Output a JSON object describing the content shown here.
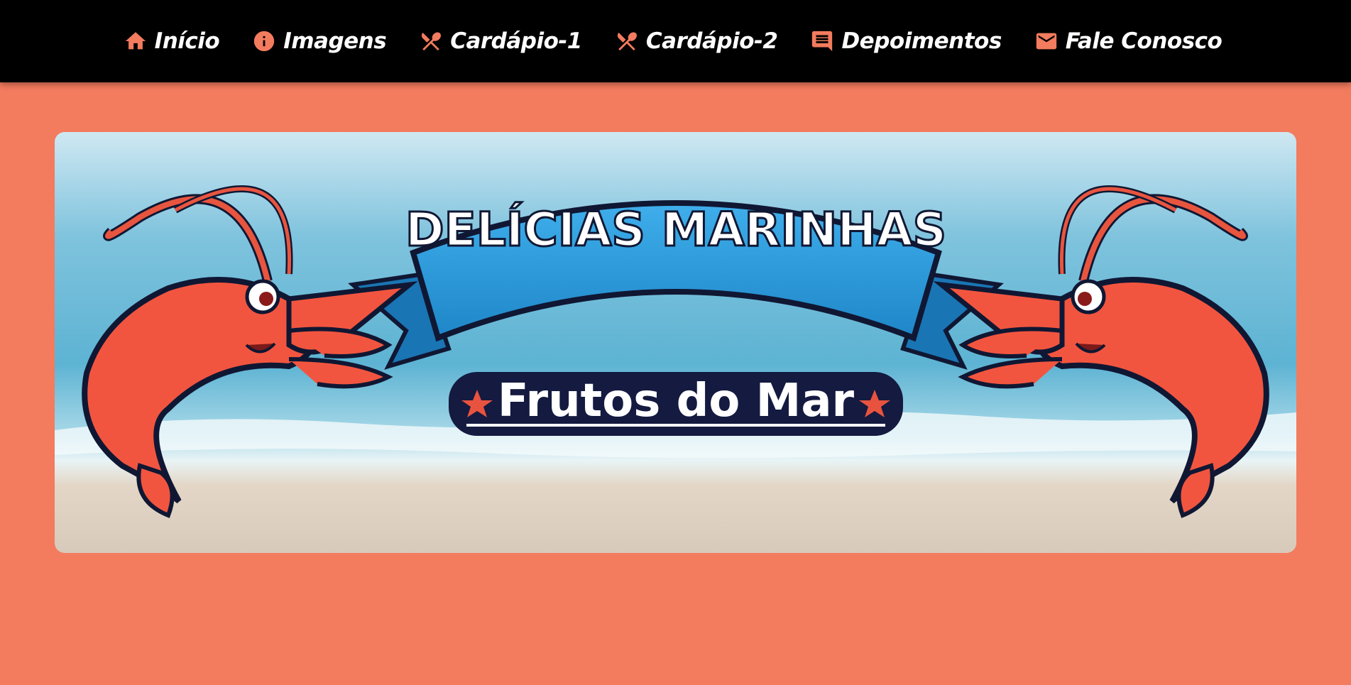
{
  "nav": {
    "items": [
      {
        "label": "Início",
        "icon": "home-icon"
      },
      {
        "label": "Imagens",
        "icon": "info-icon"
      },
      {
        "label": "Cardápio-1",
        "icon": "utensils-icon"
      },
      {
        "label": "Cardápio-2",
        "icon": "utensils-icon"
      },
      {
        "label": "Depoimentos",
        "icon": "comment-icon"
      },
      {
        "label": "Fale Conosco",
        "icon": "mail-icon"
      }
    ]
  },
  "banner": {
    "title": "DELÍCIAS MARINHAS",
    "subtitle": "Frutos do Mar"
  },
  "colors": {
    "background": "#F37B5E",
    "navbar": "#000000",
    "accent": "#F37B5E",
    "ribbon": "#2E9BDD",
    "label_bg": "#141A40"
  }
}
